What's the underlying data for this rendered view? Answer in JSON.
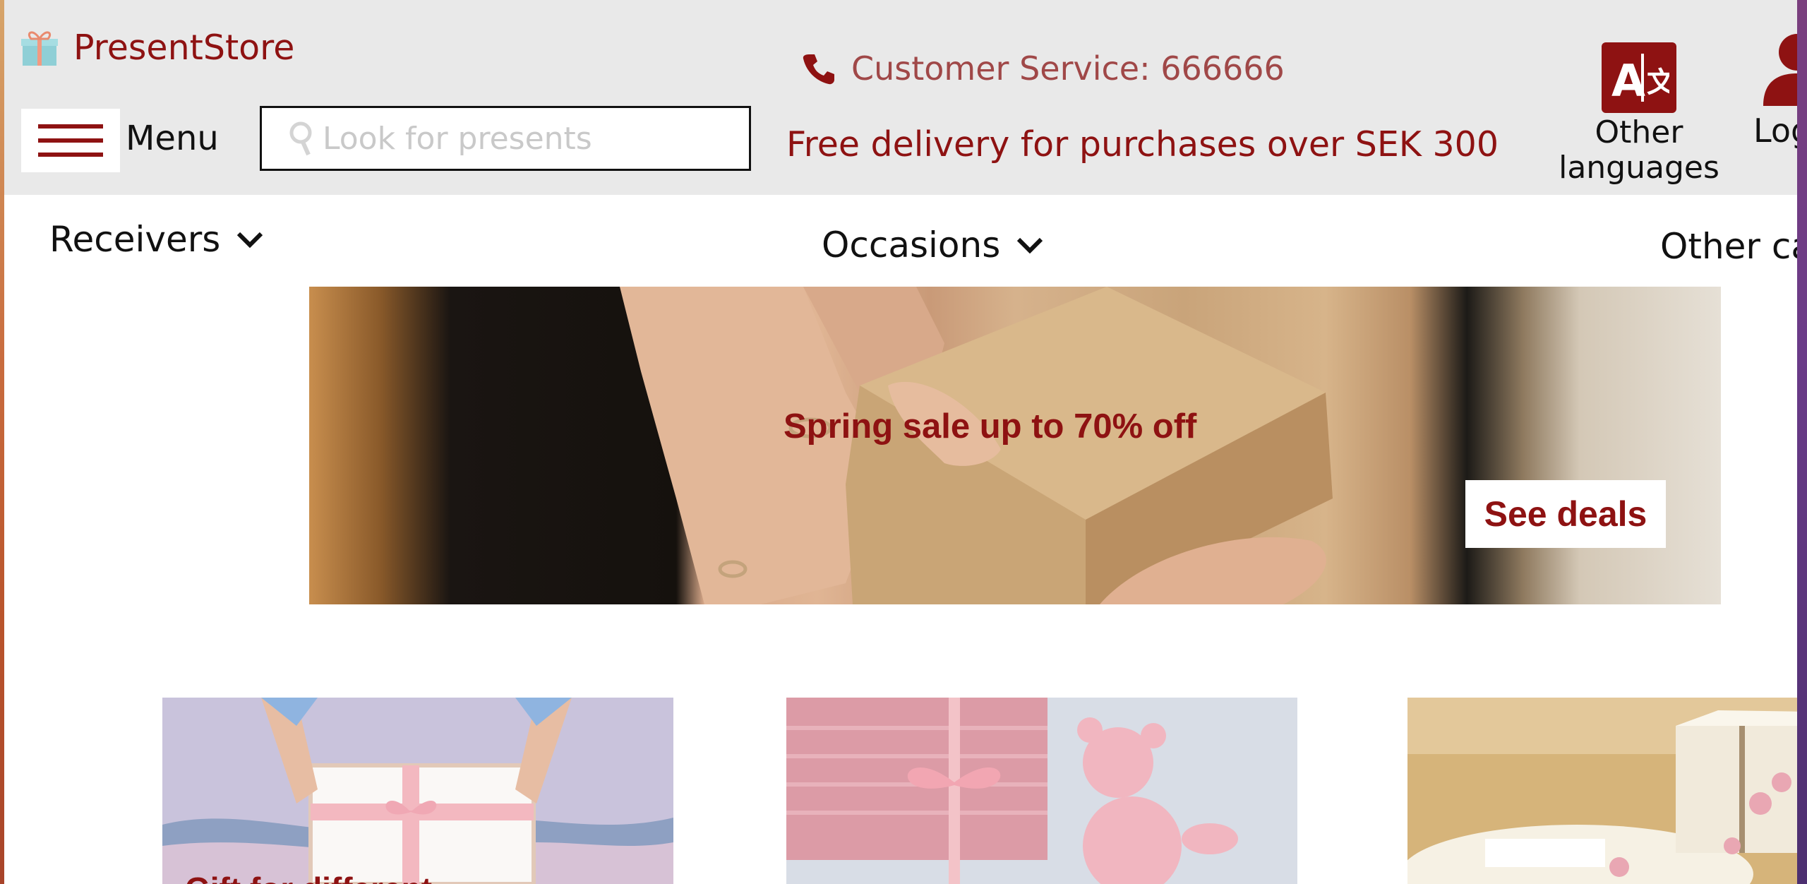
{
  "header": {
    "brand": "PresentStore",
    "menu_label": "Menu",
    "search_placeholder": "Look for presents",
    "customer_service": "Customer Service: 666666",
    "free_delivery": "Free delivery for purchases over SEK 300",
    "language_label_line1": "Other",
    "language_label_line2": "languages",
    "login_label": "Log"
  },
  "nav": {
    "receivers": "Receivers",
    "occasions": "Occasions",
    "other": "Other ca"
  },
  "banner": {
    "headline": "Spring sale up to 70% off",
    "cta": "See deals"
  },
  "cards": [
    {
      "title": "Gift for different ..."
    },
    {
      "title": ""
    },
    {
      "title": ""
    }
  ],
  "colors": {
    "brand_red": "#8e1212",
    "header_bg": "#e9e9e9",
    "text": "#111111"
  }
}
